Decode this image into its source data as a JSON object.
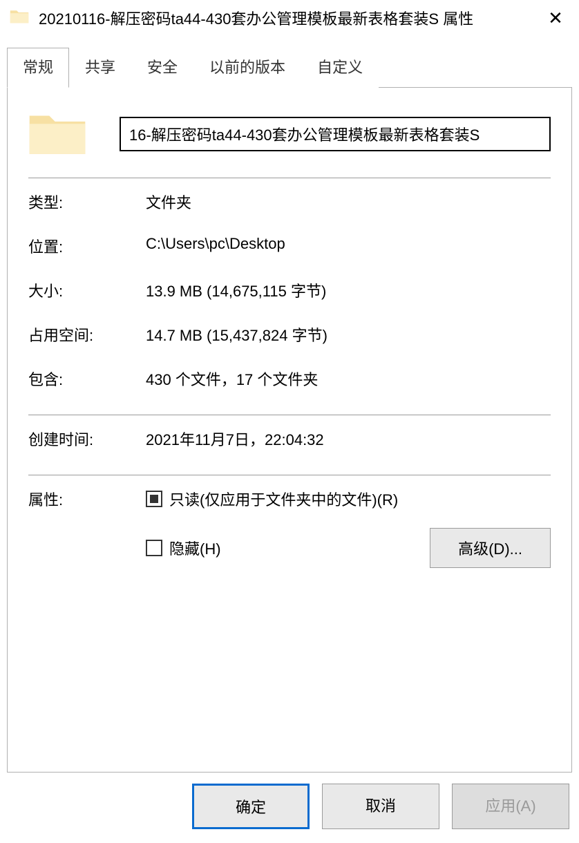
{
  "titlebar": {
    "text": "20210116-解压密码ta44-430套办公管理模板最新表格套装S 属性"
  },
  "tabs": [
    {
      "label": "常规",
      "active": true
    },
    {
      "label": "共享",
      "active": false
    },
    {
      "label": "安全",
      "active": false
    },
    {
      "label": "以前的版本",
      "active": false
    },
    {
      "label": "自定义",
      "active": false
    }
  ],
  "general": {
    "name_value": "16-解压密码ta44-430套办公管理模板最新表格套装S",
    "type_label": "类型:",
    "type_value": "文件夹",
    "location_label": "位置:",
    "location_value": "C:\\Users\\pc\\Desktop",
    "size_label": "大小:",
    "size_value": "13.9 MB (14,675,115 字节)",
    "ondisk_label": "占用空间:",
    "ondisk_value": "14.7 MB (15,437,824 字节)",
    "contains_label": "包含:",
    "contains_value": "430 个文件，17 个文件夹",
    "created_label": "创建时间:",
    "created_value": "2021年11月7日，22:04:32",
    "attributes_label": "属性:",
    "readonly_label": "只读(仅应用于文件夹中的文件)(R)",
    "hidden_label": "隐藏(H)",
    "advanced_label": "高级(D)..."
  },
  "footer": {
    "ok": "确定",
    "cancel": "取消",
    "apply": "应用(A)"
  }
}
